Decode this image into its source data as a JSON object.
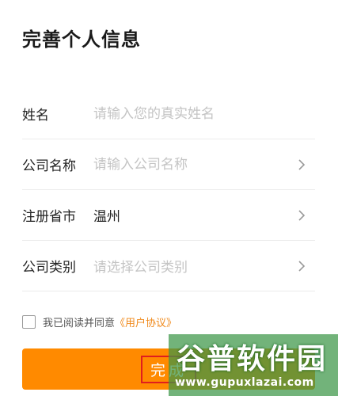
{
  "page": {
    "title": "完善个人信息"
  },
  "form": {
    "name": {
      "label": "姓名",
      "placeholder": "请输入您的真实姓名"
    },
    "company_name": {
      "label": "公司名称",
      "placeholder": "请输入公司名称"
    },
    "province_city": {
      "label": "注册省市",
      "value": "温州"
    },
    "company_type": {
      "label": "公司类别",
      "placeholder": "请选择公司类别"
    }
  },
  "agreement": {
    "text": "我已阅读并同意",
    "link": "《用户协议》",
    "checked": false
  },
  "submit": {
    "label": "完成"
  },
  "watermark": {
    "brand": "谷普软件园",
    "url": "www.gupuxlazai.com"
  },
  "colors": {
    "accent": "#ff8a00",
    "link": "#f08a1c",
    "watermark": "#3c9646"
  },
  "icons": {
    "chevron": "chevron-right-icon"
  }
}
